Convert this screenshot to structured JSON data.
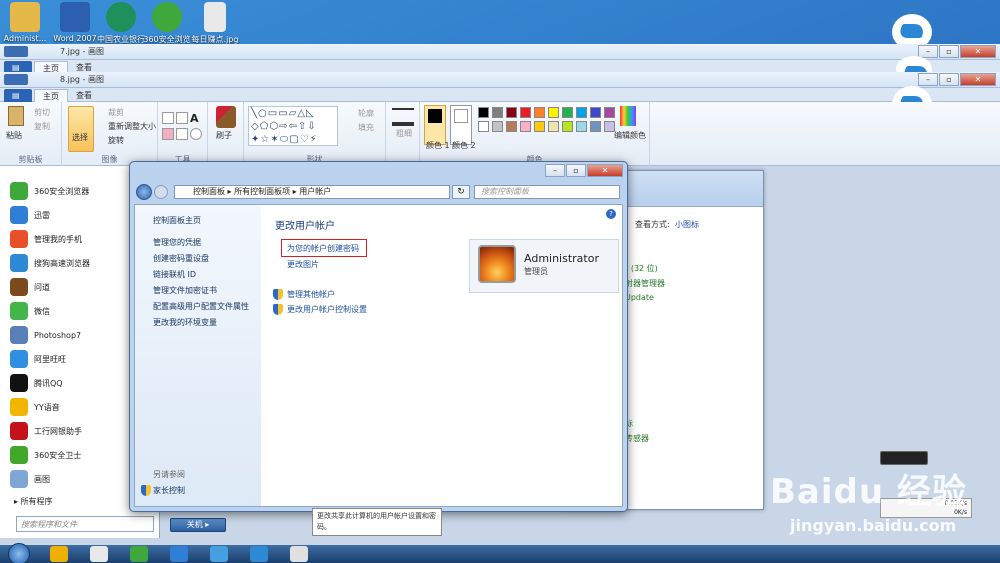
{
  "desktop": {
    "icons": [
      {
        "label": "Administ...",
        "color": "#e5b84a"
      },
      {
        "label": "Word 2007",
        "color": "#2c5fb0"
      },
      {
        "label": "中国农业银行",
        "color": "#1f8f5c"
      },
      {
        "label": "360安全浏览",
        "color": "#3ea83a"
      },
      {
        "label": "每日赚点.jpg",
        "color": "#e9e9e9"
      }
    ]
  },
  "paint_back": {
    "title": "7.jpg - 画图",
    "tab_home": "主页",
    "tab_view": "查看"
  },
  "paint": {
    "title": "8.jpg - 画图",
    "tab_home": "主页",
    "tab_view": "查看",
    "clipboard": {
      "paste": "粘贴",
      "cut": "剪切",
      "copy": "复制",
      "group": "剪贴板"
    },
    "image": {
      "select": "选择",
      "crop": "裁剪",
      "resize": "重新调整大小",
      "rotate": "旋转",
      "group": "图像"
    },
    "tools": {
      "group": "工具"
    },
    "brush": "刷子",
    "shapes": {
      "outline": "轮廓",
      "fill": "填充",
      "group": "形状"
    },
    "size": "粗细",
    "color1": "颜色 1",
    "color2": "颜色 2",
    "edit_colors": "编辑颜色",
    "colors_group": "颜色",
    "palette": [
      "#000000",
      "#7f7f7f",
      "#880015",
      "#ed1c24",
      "#ff7f27",
      "#fff200",
      "#22b14c",
      "#00a2e8",
      "#3f48cc",
      "#a349a4",
      "#ffffff",
      "#c3c3c3",
      "#b97a57",
      "#ffaec9",
      "#ffc90e",
      "#efe4b0",
      "#b5e61d",
      "#99d9ea",
      "#7092be",
      "#c8bfe7"
    ]
  },
  "start_menu": {
    "items": [
      {
        "label": "360安全浏览器",
        "color": "#3ea83a"
      },
      {
        "label": "迅雷",
        "color": "#2f7fd6"
      },
      {
        "label": "管理我的手机",
        "color": "#e8502a"
      },
      {
        "label": "搜狗高速浏览器",
        "color": "#2f8ad6"
      },
      {
        "label": "问道",
        "color": "#7a4a1c"
      },
      {
        "label": "微信",
        "color": "#44b549"
      },
      {
        "label": "Photoshop7",
        "color": "#5a7fb6"
      },
      {
        "label": "阿里旺旺",
        "color": "#2f8fe0"
      },
      {
        "label": "腾讯QQ",
        "color": "#111111"
      },
      {
        "label": "YY语音",
        "color": "#f2b600"
      },
      {
        "label": "工行网银助手",
        "color": "#c4121b"
      },
      {
        "label": "360安全卫士",
        "color": "#43a829"
      },
      {
        "label": "画图",
        "color": "#7fa7d6"
      }
    ],
    "all_programs": "所有程序",
    "search_placeholder": "搜索程序和文件",
    "shutdown": "关机"
  },
  "back_window": {
    "view_label": "查看方式:",
    "view_value": "小图标",
    "items": [
      "r (32 位)",
      "射器管理器",
      "Update",
      "标",
      "传感器"
    ]
  },
  "dialog": {
    "breadcrumb": [
      "控制面板",
      "所有控制面板项",
      "用户帐户"
    ],
    "search_placeholder": "搜索控制面板",
    "left_links": [
      "控制面板主页",
      "管理您的凭据",
      "创建密码重设盘",
      "链接联机 ID",
      "管理文件加密证书",
      "配置高级用户配置文件属性",
      "更改我的环境变量"
    ],
    "see_also": "另请参阅",
    "parental": "家长控制",
    "page_title": "更改用户帐户",
    "create_password": "为您的帐户创建密码",
    "change_picture": "更改图片",
    "manage_other": "管理其他帐户",
    "uac_settings": "更改用户帐户控制设置",
    "account_name": "Administrator",
    "account_role": "管理员"
  },
  "tooltip": "更改共享此计算机的用户帐户设置和密码。",
  "netspeed": {
    "up": "0.03K/s",
    "down": "0K/s"
  },
  "watermark": {
    "logo": "Baidu 经验",
    "url": "jingyan.baidu.com"
  },
  "taskbar": {
    "icons": [
      "#f0b000",
      "#e8e8e8",
      "#3ea83a",
      "#2f7fd6",
      "#44a0e0",
      "#2f8ad6",
      "#e0e0e0"
    ]
  }
}
